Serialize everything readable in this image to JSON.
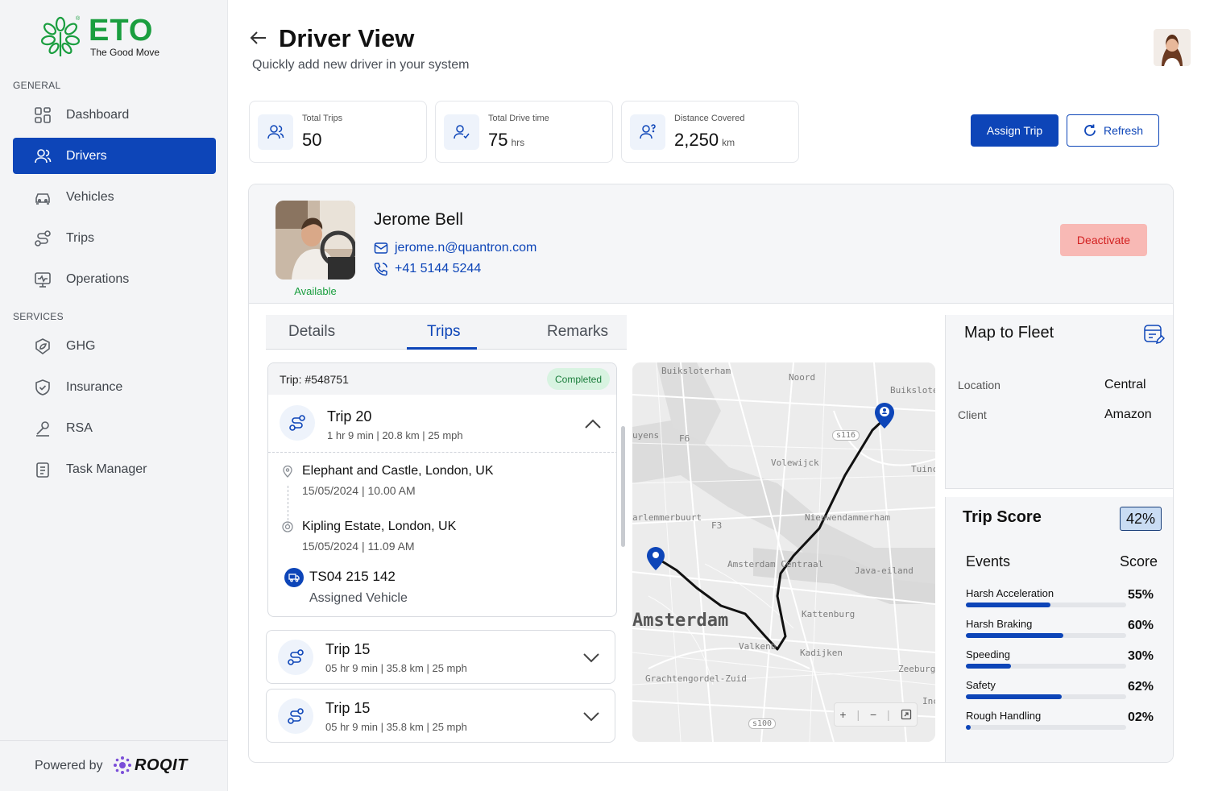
{
  "brand": {
    "name": "ETO",
    "tagline": "The Good Move",
    "reg": "®"
  },
  "sidebar": {
    "general_label": "GENERAL",
    "services_label": "SERVICES",
    "general_items": [
      {
        "label": "Dashboard",
        "icon": "grid-icon"
      },
      {
        "label": "Drivers",
        "icon": "users-icon",
        "active": true
      },
      {
        "label": "Vehicles",
        "icon": "car-icon"
      },
      {
        "label": "Trips",
        "icon": "route-icon"
      },
      {
        "label": "Operations",
        "icon": "monitor-icon"
      }
    ],
    "service_items": [
      {
        "label": "GHG",
        "icon": "leaf-icon"
      },
      {
        "label": "Insurance",
        "icon": "shield-icon"
      },
      {
        "label": "RSA",
        "icon": "tools-icon"
      },
      {
        "label": "Task Manager",
        "icon": "clipboard-icon"
      }
    ],
    "powered_by": "Powered by",
    "powered_brand": "ROQIT"
  },
  "header": {
    "title": "Driver View",
    "subtitle": "Quickly add new driver in your system"
  },
  "stats": [
    {
      "label": "Total Trips",
      "value": "50",
      "unit": ""
    },
    {
      "label": "Total Drive time",
      "value": "75",
      "unit": "hrs"
    },
    {
      "label": "Distance Covered",
      "value": "2,250",
      "unit": "km"
    }
  ],
  "actions": {
    "assign": "Assign Trip",
    "refresh": "Refresh"
  },
  "driver": {
    "name": "Jerome Bell",
    "email": "jerome.n@quantron.com",
    "phone": "+41 5144 5244",
    "status": "Available",
    "deactivate": "Deactivate"
  },
  "tabs": [
    "Details",
    "Trips",
    "Remarks"
  ],
  "trip_expanded": {
    "id": "Trip: #548751",
    "status": "Completed",
    "title": "Trip 20",
    "meta": "1 hr 9 min | 20.8 km | 25 mph",
    "from": {
      "place": "Elephant and Castle, London, UK",
      "time": "15/05/2024  |  10.00 AM"
    },
    "to": {
      "place": "Kipling Estate, London, UK",
      "time": "15/05/2024  |  11.09 AM"
    },
    "vehicle": "TS04 215 142",
    "vehicle_label": "Assigned Vehicle"
  },
  "trips_collapsed": [
    {
      "title": "Trip 15",
      "meta": "05 hr 9 min | 35.8 km | 25 mph"
    },
    {
      "title": "Trip 15",
      "meta": "05 hr 9 min | 35.8 km | 25 mph"
    }
  ],
  "map": {
    "labels": [
      "Buiksloterham",
      "Noord",
      "Buiksloterh",
      "s116",
      "F6",
      "Volewijck",
      "Tuinc",
      "arlemmerbuurt",
      "F3",
      "Nieuwendammerham",
      "Amsterdam Centraal",
      "Java-eiland",
      "Kattenburg",
      "Valkenb",
      "Kadijken",
      "Zeeburg",
      "Grachtengordel-Zuid",
      "s100",
      "Inc",
      "uyens"
    ],
    "city": "Amsterdam",
    "controls": {
      "zoom_in": "+",
      "zoom_out": "−"
    }
  },
  "fleet": {
    "title": "Map to Fleet",
    "rows": [
      {
        "key": "Location",
        "value": "Central"
      },
      {
        "key": "Client",
        "value": "Amazon"
      }
    ]
  },
  "trip_score": {
    "title": "Trip Score",
    "value": "42%",
    "events_label": "Events",
    "score_label": "Score",
    "events": [
      {
        "name": "Harsh Acceleration",
        "value": "55%",
        "fraction": 0.53
      },
      {
        "name": "Harsh Braking",
        "value": "60%",
        "fraction": 0.61
      },
      {
        "name": "Speeding",
        "value": "30%",
        "fraction": 0.28
      },
      {
        "name": "Safety",
        "value": "62%",
        "fraction": 0.6
      },
      {
        "name": "Rough Handling",
        "value": "02%",
        "fraction": 0.03
      }
    ]
  }
}
